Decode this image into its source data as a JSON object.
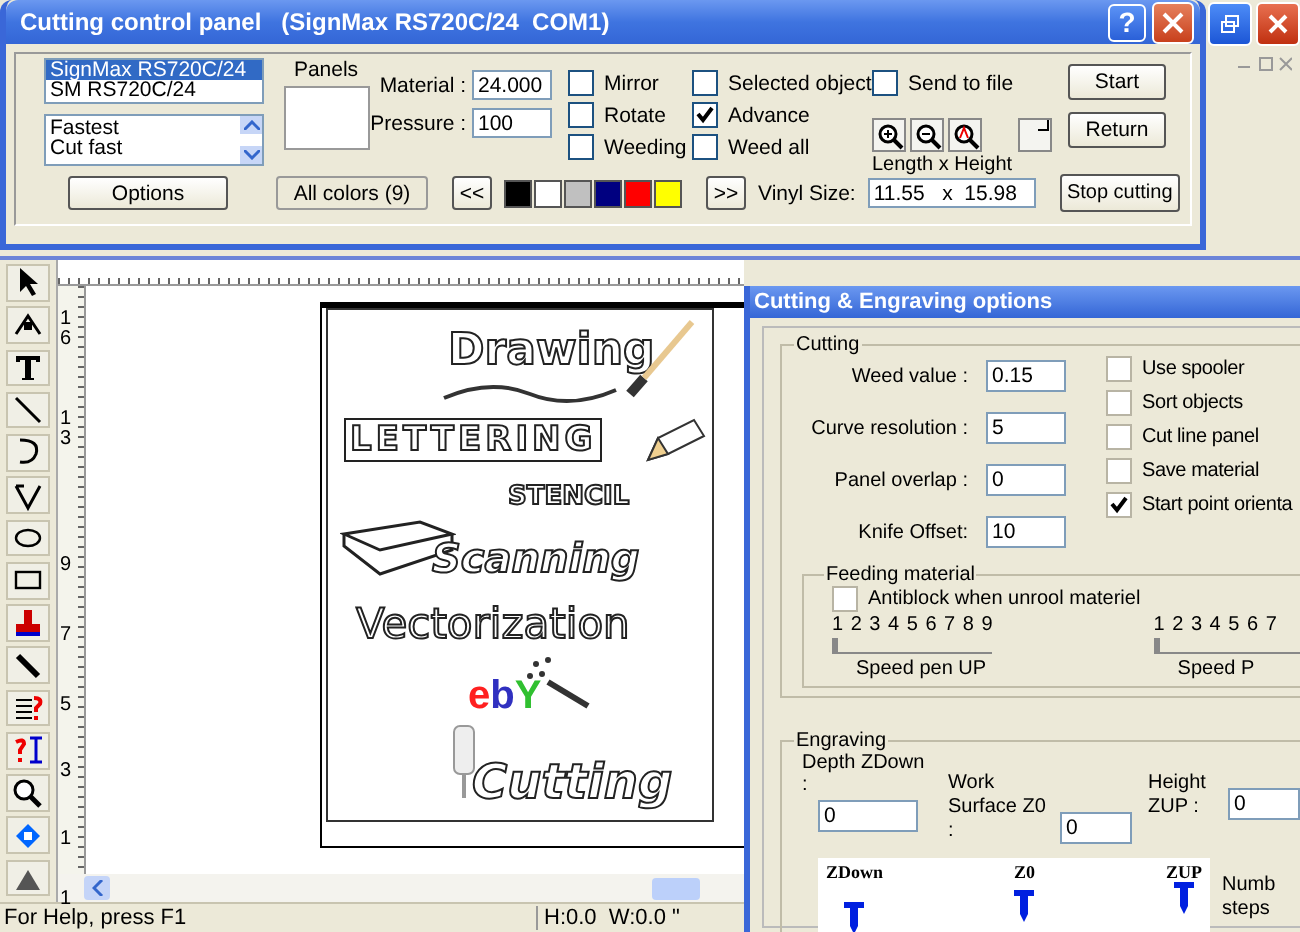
{
  "control_panel": {
    "title": "Cutting control panel   (SignMax RS720C/24  COM1)",
    "help_button": "?",
    "devices": [
      {
        "label": "SignMax RS720C/24",
        "selected": true
      },
      {
        "label": "SM RS720C/24",
        "selected": false
      }
    ],
    "speeds": [
      "Fastest",
      "Cut fast"
    ],
    "panels_label": "Panels",
    "material": {
      "label": "Material :",
      "value": "24.000"
    },
    "pressure": {
      "label": "Pressure :",
      "value": "100"
    },
    "checkbox_columns": [
      [
        {
          "label": "Mirror",
          "checked": false
        },
        {
          "label": "Rotate",
          "checked": false
        },
        {
          "label": "Weeding",
          "checked": false
        }
      ],
      [
        {
          "label": "Selected object",
          "checked": false
        },
        {
          "label": "Advance",
          "checked": true
        },
        {
          "label": "Weed all",
          "checked": false
        }
      ],
      [
        {
          "label": "Send to file",
          "checked": false
        }
      ]
    ],
    "zoom_caption": "Length x Height",
    "start_button": "Start",
    "return_button": "Return",
    "options_button": "Options",
    "colors_button": "All colors (9)",
    "prev_button": "<<",
    "next_button": ">>",
    "swatches": [
      {
        "color": "#000000"
      },
      {
        "color": "#ffffff"
      },
      {
        "color": "#c0c0c0"
      },
      {
        "color": "#000080"
      },
      {
        "color": "#ff0000"
      },
      {
        "color": "#ffff00"
      }
    ],
    "vinyl_size": {
      "label": "Vinyl Size:",
      "value": "11.55   x  15.98"
    },
    "stop_button": "Stop cutting"
  },
  "ruler_labels": [
    "16",
    "13",
    "9",
    "7",
    "5",
    "3",
    "1",
    "1"
  ],
  "artwork": {
    "words": [
      "Drawing",
      "LETTERING",
      "STENCIL",
      "Scanning",
      "Vectorization",
      "Cutting"
    ],
    "logo_letters": [
      {
        "text": "e",
        "color": "#ff2020"
      },
      {
        "text": "b",
        "color": "#3030c0"
      },
      {
        "text": "Y",
        "color": "#30c030"
      }
    ]
  },
  "status_bar": {
    "help": "For Help, press F1",
    "size": "H:0.0  W:0.0 \""
  },
  "options_window": {
    "title": "Cutting & Engraving options",
    "cutting": {
      "title": "Cutting",
      "fields": [
        {
          "label": "Weed value :",
          "value": "0.15"
        },
        {
          "label": "Curve resolution :",
          "value": "5"
        },
        {
          "label": "Panel overlap :",
          "value": "0"
        },
        {
          "label": "Knife Offset:",
          "value": "10"
        }
      ],
      "checkboxes": [
        {
          "label": "Use spooler",
          "checked": false
        },
        {
          "label": "Sort objects",
          "checked": false
        },
        {
          "label": "Cut line panel",
          "checked": false
        },
        {
          "label": "Save material",
          "checked": false
        },
        {
          "label": "Start point orienta",
          "checked": true
        }
      ]
    },
    "feeding": {
      "title": "Feeding material",
      "antiblock": {
        "label": "Antiblock when unrool materiel",
        "checked": false
      },
      "sliders": [
        {
          "scale": "1 2 3 4 5 6 7 8 9",
          "level": 0,
          "label": "Speed pen UP"
        },
        {
          "scale": "1 2 3 4 5 6 7",
          "level": 0,
          "label": "Speed P"
        }
      ]
    },
    "engraving": {
      "title": "Engraving",
      "fields": [
        {
          "label": "Depth ZDown :",
          "value": "0"
        },
        {
          "label": "Work Surface Z0 :",
          "value": "0"
        },
        {
          "label": "Height ZUP :",
          "value": "0"
        }
      ],
      "diagram_labels": [
        "ZDown",
        "Z0",
        "ZUP"
      ],
      "steps_label": "Numb steps"
    }
  }
}
